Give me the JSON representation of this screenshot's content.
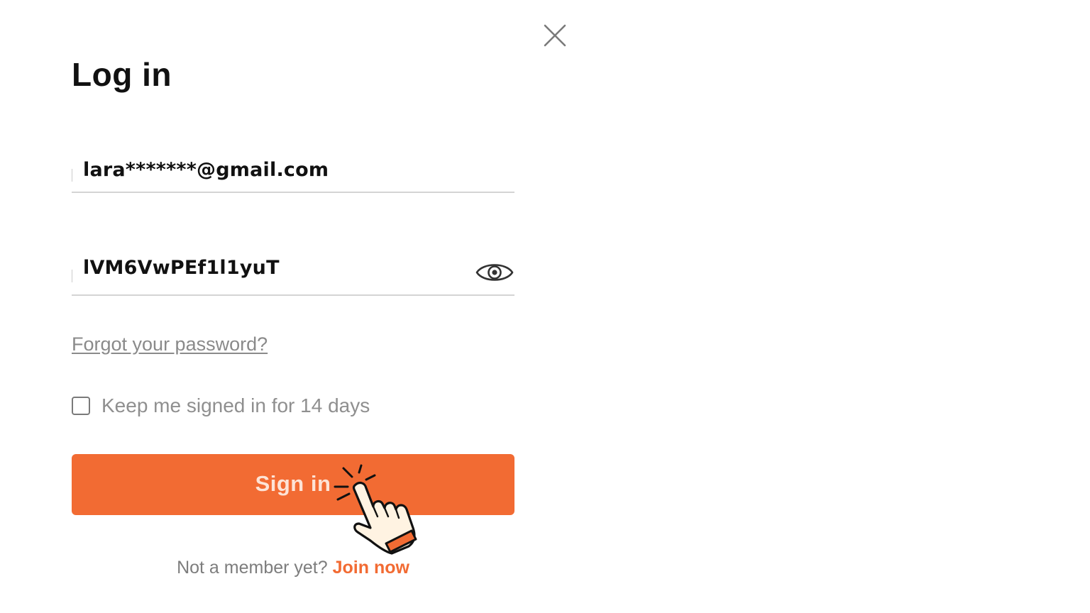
{
  "dialog": {
    "title": "Log in"
  },
  "email_field": {
    "value": "lara*******@gmail.com"
  },
  "password_field": {
    "value": "lVM6VwPEf1l1yuT"
  },
  "links": {
    "forgot_password": "Forgot your password?"
  },
  "keep_signed_in": {
    "label": "Keep me signed in for 14 days",
    "checked": false
  },
  "signin_button": {
    "label": "Sign in"
  },
  "footer": {
    "prompt": "Not a member yet?",
    "join_label": "Join now"
  },
  "icons": {
    "close": "close-icon",
    "show_password": "eye-icon",
    "pointer": "tap-hand-icon"
  },
  "colors": {
    "accent": "#f26b33",
    "button_text": "#fde3d6",
    "muted_text": "#8f8f8f",
    "title_text": "#111111"
  }
}
